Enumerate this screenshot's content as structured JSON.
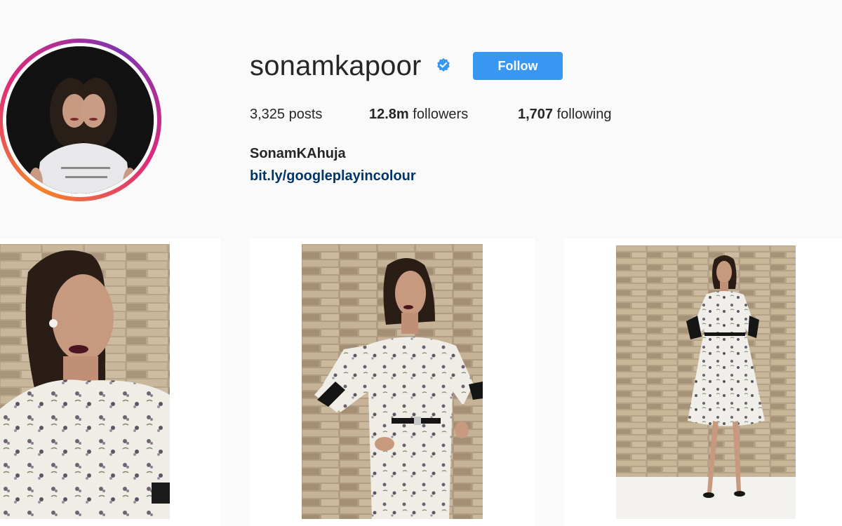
{
  "profile": {
    "username": "sonamkapoor",
    "verified_icon": "verified-badge-icon",
    "follow_label": "Follow",
    "full_name": "SonamKAhuja",
    "link": "bit.ly/googleplayincolour",
    "avatar_alt": "profile picture"
  },
  "stats": {
    "posts_count": "3,325",
    "posts_label": "posts",
    "followers_count": "12.8m",
    "followers_label": "followers",
    "following_count": "1,707",
    "following_label": "following"
  },
  "colors": {
    "accent": "#3897f0",
    "link": "#003569",
    "background": "#fafafa",
    "verified": "#3897f0"
  },
  "posts": [
    {
      "alt": "post photo 1"
    },
    {
      "alt": "post photo 2"
    },
    {
      "alt": "post photo 3"
    }
  ]
}
